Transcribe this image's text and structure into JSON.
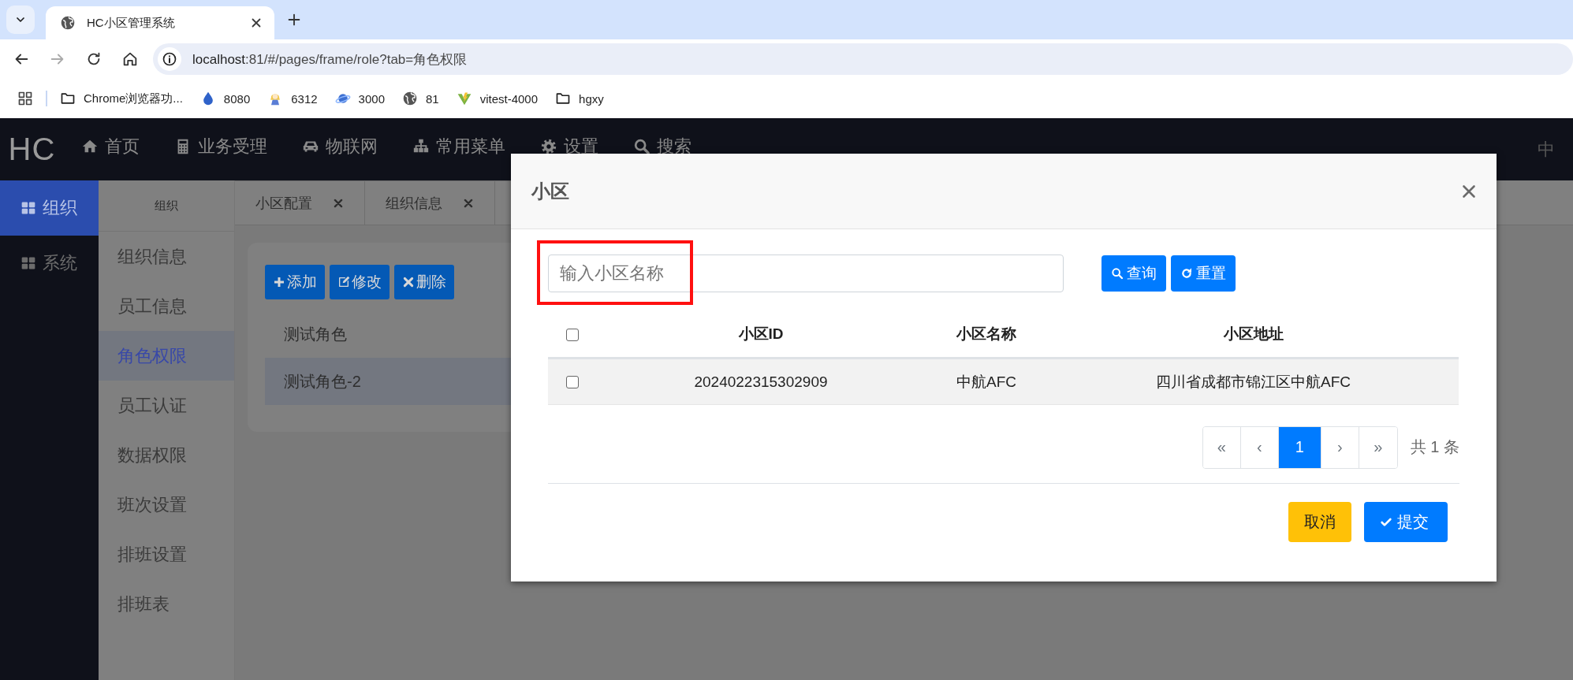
{
  "browser": {
    "tab_title": "HC小区管理系统",
    "url_host": "localhost",
    "url_rest": ":81/#/pages/frame/role?tab=角色权限",
    "bookmarks": [
      {
        "label": "Chrome浏览器功...",
        "kind": "folder"
      },
      {
        "label": "8080",
        "kind": "drop"
      },
      {
        "label": "6312",
        "kind": "figure"
      },
      {
        "label": "3000",
        "kind": "planet"
      },
      {
        "label": "81",
        "kind": "globe"
      },
      {
        "label": "vitest-4000",
        "kind": "bolt"
      },
      {
        "label": "hgxy",
        "kind": "folder"
      }
    ]
  },
  "navbar": {
    "logo": "HC",
    "items": [
      {
        "label": "首页",
        "kind": "home"
      },
      {
        "label": "业务受理",
        "kind": "calc"
      },
      {
        "label": "物联网",
        "kind": "car"
      },
      {
        "label": "常用菜单",
        "kind": "sitemap"
      },
      {
        "label": "设置",
        "kind": "gear"
      },
      {
        "label": "搜索",
        "kind": "search"
      }
    ],
    "user": "中"
  },
  "sidebar": [
    {
      "label": "组织",
      "selected": true
    },
    {
      "label": "系统",
      "selected": false
    }
  ],
  "submenu": {
    "title": "组织",
    "items": [
      {
        "label": "组织信息",
        "selected": false
      },
      {
        "label": "员工信息",
        "selected": false
      },
      {
        "label": "角色权限",
        "selected": true
      },
      {
        "label": "员工认证",
        "selected": false
      },
      {
        "label": "数据权限",
        "selected": false
      },
      {
        "label": "班次设置",
        "selected": false
      },
      {
        "label": "排班设置",
        "selected": false
      },
      {
        "label": "排班表",
        "selected": false
      }
    ]
  },
  "page_tabs": [
    {
      "label": "小区配置"
    },
    {
      "label": "组织信息"
    }
  ],
  "toolbar": [
    {
      "label": "添加",
      "kind": "plus"
    },
    {
      "label": "修改",
      "kind": "edit"
    },
    {
      "label": "删除",
      "kind": "times"
    }
  ],
  "roles": [
    {
      "label": "测试角色",
      "selected": false
    },
    {
      "label": "测试角色-2",
      "selected": true
    }
  ],
  "modal": {
    "title": "小区",
    "search": {
      "placeholder": "输入小区名称"
    },
    "search_buttons": [
      {
        "label": "查询",
        "kind": "search"
      },
      {
        "label": "重置",
        "kind": "refresh"
      }
    ],
    "table": {
      "header_checked": false,
      "columns": [
        "小区ID",
        "小区名称",
        "小区地址"
      ],
      "rows": [
        {
          "checked": false,
          "cells": [
            "2024022315302909",
            "中航AFC",
            "四川省成都市锦江区中航AFC"
          ]
        }
      ]
    },
    "pagination": {
      "pages": [
        {
          "label": "«",
          "selected": false
        },
        {
          "label": "‹",
          "selected": false
        },
        {
          "label": "1",
          "selected": true
        },
        {
          "label": "›",
          "selected": false
        },
        {
          "label": "»",
          "selected": false
        }
      ],
      "total": "共 1 条"
    },
    "footer": [
      {
        "label": "取消",
        "kind": "cancel"
      },
      {
        "label": "提交",
        "kind": "submit"
      }
    ]
  }
}
